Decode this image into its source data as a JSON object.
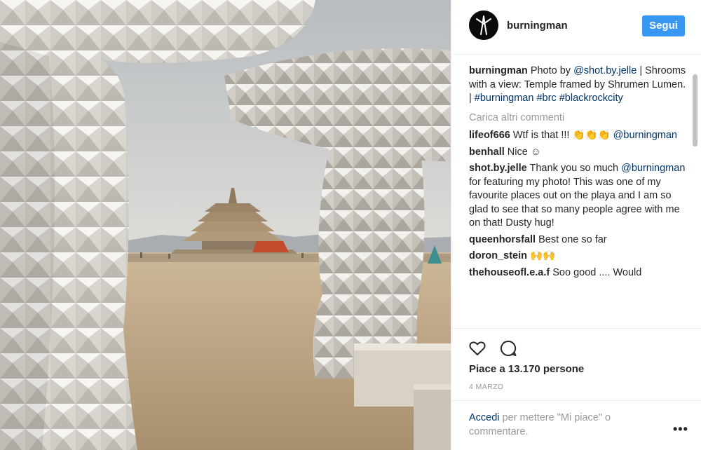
{
  "post": {
    "username": "burningman",
    "follow_label": "Segui",
    "photo_description": ""
  },
  "caption": {
    "username": "burningman",
    "text_parts": [
      "Photo by ",
      "@shot.by.jelle",
      " | Shrooms with a view: Temple framed by Shrumen Lumen. | ",
      "#burningman",
      " ",
      "#brc",
      " ",
      "#blackrockcity"
    ]
  },
  "load_more_label": "Carica altri commenti",
  "comments": [
    {
      "username": "lifeof666",
      "text": "Wtf is that !!! 👏👏👏",
      "mention": "@burningman"
    },
    {
      "username": "benhall",
      "text": "Nice ☺"
    },
    {
      "username": "shot.by.jelle",
      "text_before": "Thank you so much ",
      "mention": "@burningman",
      "text_after": " for featuring my photo! This was one of my favourite places out on the playa and I am so glad to see that so many people agree with me on that! Dusty hug!"
    },
    {
      "username": "queenhorsfall",
      "text": "Best one so far"
    },
    {
      "username": "doron_stein",
      "text": "🙌🙌"
    },
    {
      "username": "thehouseofl.e.a.f",
      "text": "Soo good .... Would"
    }
  ],
  "likes_text": "Piace a 13.170 persone",
  "date_text": "4 MARZO",
  "login": {
    "link": "Accedi",
    "text": " per mettere \"Mi piace\" o commentare."
  },
  "more_label": "•••",
  "colors": {
    "accent": "#3897f0",
    "link": "#003569",
    "muted": "#999999"
  },
  "icons": [
    "heart-icon",
    "comment-icon",
    "more-options-icon"
  ]
}
